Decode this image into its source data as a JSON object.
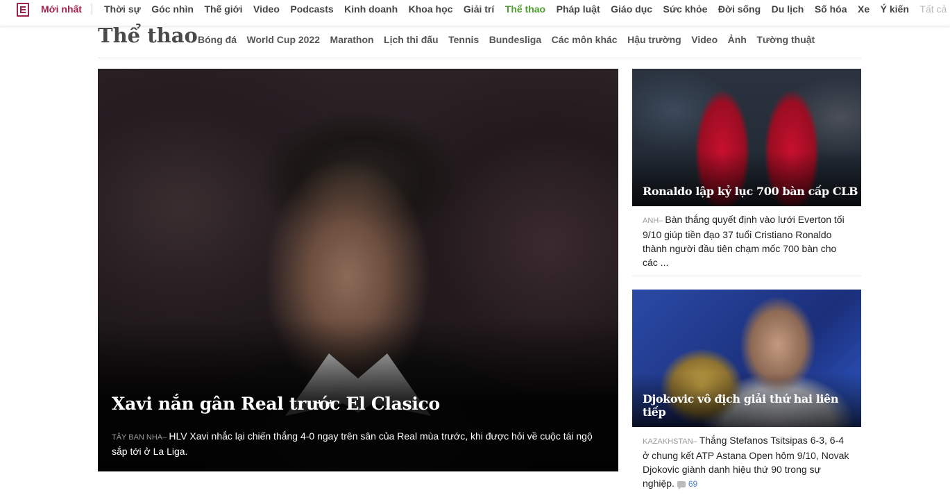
{
  "topnav": {
    "latest": "Mới nhất",
    "items": [
      "Thời sự",
      "Góc nhìn",
      "Thế giới",
      "Video",
      "Podcasts",
      "Kinh doanh",
      "Khoa học",
      "Giải trí",
      "Thể thao",
      "Pháp luật",
      "Giáo dục",
      "Sức khỏe",
      "Đời sống",
      "Du lịch",
      "Số hóa",
      "Xe",
      "Ý kiến"
    ],
    "active": "Thể thao",
    "overflow": "Tất cả"
  },
  "section": {
    "title": "Thể thao",
    "subnav": [
      "Bóng đá",
      "World Cup 2022",
      "Marathon",
      "Lịch thi đấu",
      "Tennis",
      "Bundesliga",
      "Các môn khác",
      "Hậu trường",
      "Video",
      "Ảnh",
      "Tường thuật"
    ]
  },
  "feature": {
    "title": "Xavi nắn gân Real trước El Clasico",
    "location": "Tây Ban Nha",
    "desc": "HLV Xavi nhắc lại chiến thắng 4-0 ngay trên sân của Real mùa trước, khi được hỏi về cuộc tái ngộ sắp tới ở La Liga."
  },
  "cards": [
    {
      "title": "Ronaldo lập kỷ lục 700 bàn cấp CLB",
      "location": "Anh",
      "desc": "Bàn thắng quyết định vào lưới Everton tối 9/10 giúp tiền đạo 37 tuổi Cristiano Ronaldo thành người đầu tiên chạm mốc 700 bàn cho các ..."
    },
    {
      "title": "Djokovic vô địch giải thứ hai liên tiếp",
      "location": "Kazakhstan",
      "desc": "Thắng Stefanos Tsitsipas 6-3, 6-4 ở chung kết ATP Astana Open hôm 9/10, Novak Djokovic giành danh hiệu thứ 90 trong sự nghiệp.",
      "comments": "69"
    }
  ],
  "colors": {
    "brand": "#9f224e",
    "active": "#4f9c2e",
    "comment": "#4f7fc9"
  }
}
